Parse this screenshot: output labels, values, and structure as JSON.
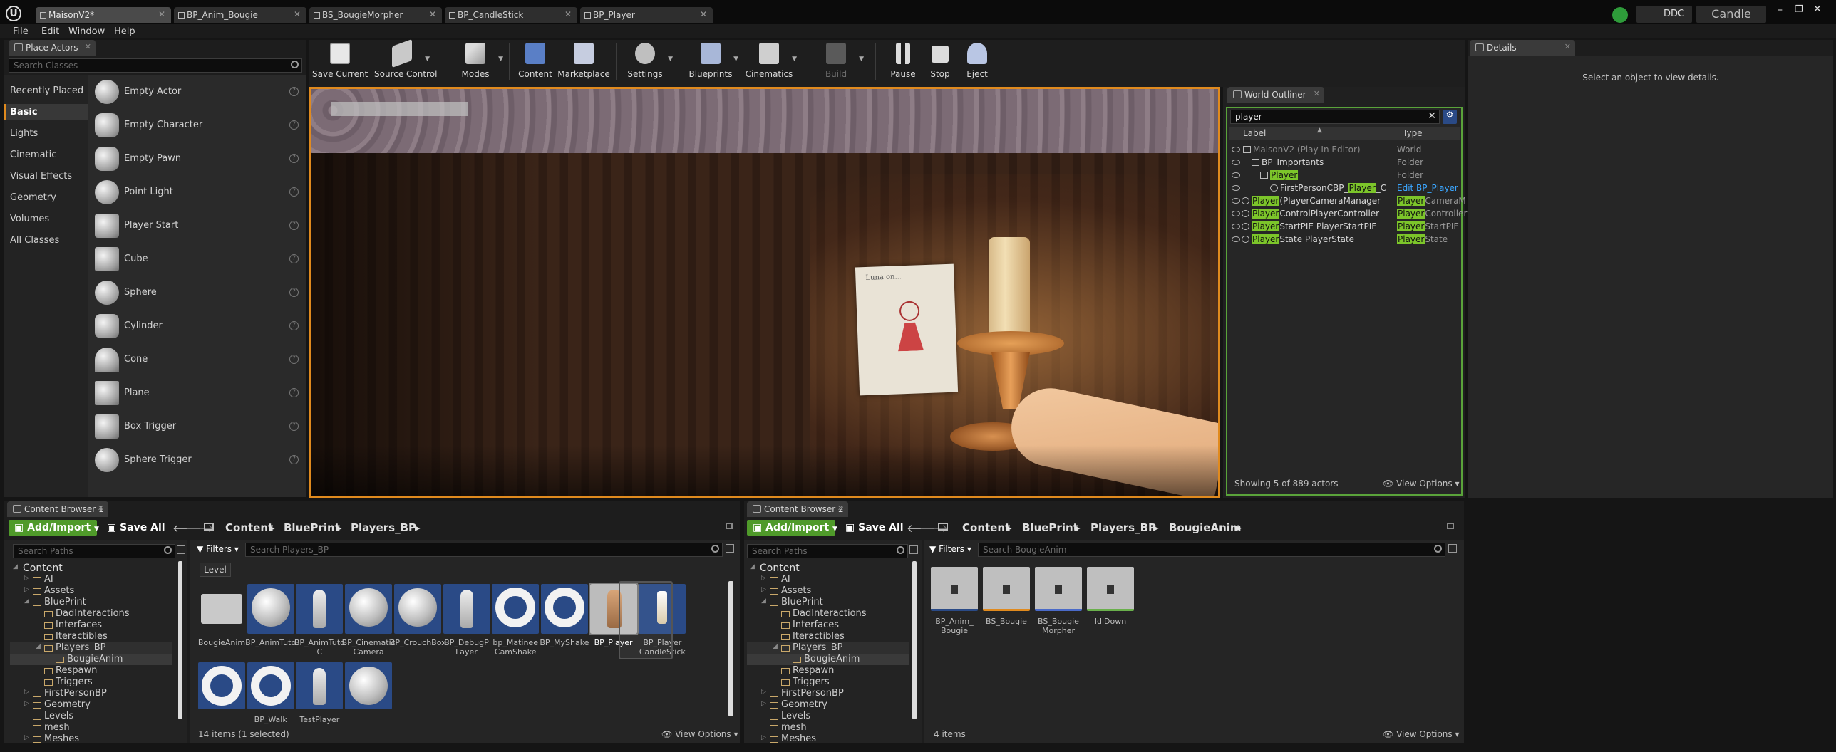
{
  "colors": {
    "accent_green": "#7cc52a",
    "highlight": "#7cc52a",
    "orange_frame": "#e08a1e",
    "edit_link": "#3ba6ff"
  },
  "tabs": [
    "MaisonV2*",
    "BP_Anim_Bougie",
    "BS_BougieMorpher",
    "BP_CandleStick",
    "BP_Player"
  ],
  "titlebar": {
    "ddc": "DDC",
    "project": "Candle"
  },
  "menu": [
    "File",
    "Edit",
    "Window",
    "Help"
  ],
  "place_actors": {
    "tab": "Place Actors",
    "search_placeholder": "Search Classes",
    "categories": [
      "Recently Placed",
      "Basic",
      "Lights",
      "Cinematic",
      "Visual Effects",
      "Geometry",
      "Volumes",
      "All Classes"
    ],
    "actors": [
      "Empty Actor",
      "Empty Character",
      "Empty Pawn",
      "Point Light",
      "Player Start",
      "Cube",
      "Sphere",
      "Cylinder",
      "Cone",
      "Plane",
      "Box Trigger",
      "Sphere Trigger"
    ]
  },
  "toolbar": {
    "buttons": [
      "Save Current",
      "Source Control",
      "Modes",
      "Content",
      "Marketplace",
      "Settings",
      "Blueprints",
      "Cinematics",
      "Build",
      "Pause",
      "Stop",
      "Eject"
    ]
  },
  "viewport": {
    "note_text": "Luna on..."
  },
  "outliner": {
    "tab": "World Outliner",
    "search_value": "player",
    "col_label": "Label",
    "col_type": "Type",
    "rows": [
      {
        "pre": "MaisonV2 (Play In Editor)",
        "hl": "",
        "post": "",
        "type_hl": "",
        "type": "World"
      },
      {
        "pre": "BP_Importants",
        "hl": "",
        "post": "",
        "type_hl": "",
        "type": "Folder"
      },
      {
        "pre": "",
        "hl": "Player",
        "post": "",
        "type_hl": "",
        "type": "Folder"
      },
      {
        "pre": "FirstPersonCBP_",
        "hl": "Player",
        "post": "_C",
        "type_hl": "",
        "type": "Edit BP_Player"
      },
      {
        "pre": "",
        "hl": "Player",
        "post": "(PlayerCameraManager",
        "type_hl": "Player",
        "type": "CameraM"
      },
      {
        "pre": "",
        "hl": "Player",
        "post": "ControlPlayerController",
        "type_hl": "Player",
        "type": "Controller"
      },
      {
        "pre": "",
        "hl": "Player",
        "post": "StartPIE  PlayerStartPIE",
        "type_hl": "Player",
        "type": "StartPIE"
      },
      {
        "pre": "",
        "hl": "Player",
        "post": "State          PlayerState",
        "type_hl": "Player",
        "type": "State"
      }
    ],
    "status": "Showing 5 of 889 actors",
    "view_options": "View Options"
  },
  "details": {
    "tab": "Details",
    "empty_msg": "Select an object to view details."
  },
  "cb1": {
    "tab": "Content Browser 1",
    "add_import": "Add/Import",
    "save_all": "Save All",
    "breadcrumb": [
      "Content",
      "BluePrint",
      "Players_BP"
    ],
    "search_paths": "Search Paths",
    "filters": "Filters",
    "search_placeholder": "Search Players_BP",
    "level_chip": "Level",
    "tree": [
      "Content",
      "AI",
      "Assets",
      "BluePrint",
      "DadInteractions",
      "Interfaces",
      "Iteractibles",
      "Players_BP",
      "BougieAnim",
      "Respawn",
      "Triggers",
      "FirstPersonBP",
      "Geometry",
      "Levels",
      "mesh",
      "Meshes"
    ],
    "assets_row1": [
      "BougieAnim",
      "BP_AnimTuto",
      "BP_AnimTuto C",
      "BP_Cinematic Camera",
      "BP_CrouchBox",
      "BP_DebugP Layer",
      "bp_Matinee CamShake",
      "BP_MyShake",
      "BP_Player",
      "BP_Player CandleStick"
    ],
    "assets_row2": [
      "",
      "BP_Walk",
      "TestPlayer",
      ""
    ],
    "status": "14 items (1 selected)",
    "view_options": "View Options"
  },
  "cb2": {
    "tab": "Content Browser 2",
    "add_import": "Add/Import",
    "save_all": "Save All",
    "breadcrumb": [
      "Content",
      "BluePrint",
      "Players_BP",
      "BougieAnim"
    ],
    "search_paths": "Search Paths",
    "filters": "Filters",
    "search_placeholder": "Search BougieAnim",
    "tree": [
      "Content",
      "AI",
      "Assets",
      "BluePrint",
      "DadInteractions",
      "Interfaces",
      "Iteractibles",
      "Players_BP",
      "BougieAnim",
      "Respawn",
      "Triggers",
      "FirstPersonBP",
      "Geometry",
      "Levels",
      "mesh",
      "Meshes"
    ],
    "assets": [
      "BP_Anim_ Bougie",
      "BS_Bougie",
      "BS_Bougie Morpher",
      "IdlDown"
    ],
    "status": "4 items",
    "view_options": "View Options"
  }
}
